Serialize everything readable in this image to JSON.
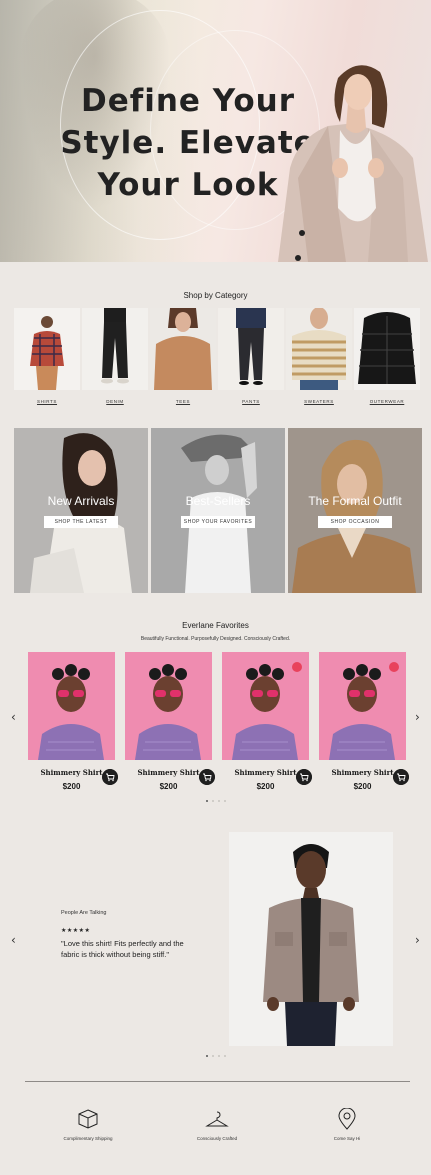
{
  "hero": {
    "title": "Define Your Style. Elevate Your Look"
  },
  "categories": {
    "title": "Shop by Category",
    "items": [
      {
        "label": "SHIRTS"
      },
      {
        "label": "DENIM"
      },
      {
        "label": "TEES"
      },
      {
        "label": "PANTS"
      },
      {
        "label": "SWEATERS"
      },
      {
        "label": "OUTERWEAR"
      }
    ]
  },
  "features": [
    {
      "title": "New Arrivals",
      "button": "SHOP THE LATEST"
    },
    {
      "title": "Best-Sellers",
      "button": "SHOP YOUR FAVORITES"
    },
    {
      "title": "The Formal Outfit",
      "button": "SHOP OCCASION"
    }
  ],
  "favorites": {
    "title": "Everlane Favorites",
    "subtitle": "Beautifully Functional. Purposefully Designed. Consciously Crafted.",
    "products": [
      {
        "name": "Shimmery Shirt",
        "price": "$200",
        "wishlisted": false
      },
      {
        "name": "Shimmery Shirt",
        "price": "$200",
        "wishlisted": false
      },
      {
        "name": "Shimmery Shirt",
        "price": "$200",
        "wishlisted": true
      },
      {
        "name": "Shimmery Shirt",
        "price": "$200",
        "wishlisted": true
      }
    ],
    "prev_icon": "‹",
    "next_icon": "›"
  },
  "testimonial": {
    "heading": "People Are Talking",
    "stars": "★★★★★",
    "quote": "\"Love this shirt! Fits perfectly and the fabric is thick without being stiff.\"",
    "prev_icon": "‹",
    "next_icon": "›"
  },
  "perks": [
    {
      "icon": "box-icon",
      "label": "Complimentary Shipping"
    },
    {
      "icon": "hanger-icon",
      "label": "Consciously Crafted"
    },
    {
      "icon": "location-pin-icon",
      "label": "Come Say Hi"
    }
  ],
  "colors": {
    "background": "#ece8e4",
    "product_bg": "#ef8cb0",
    "heart": "#e8425c"
  }
}
